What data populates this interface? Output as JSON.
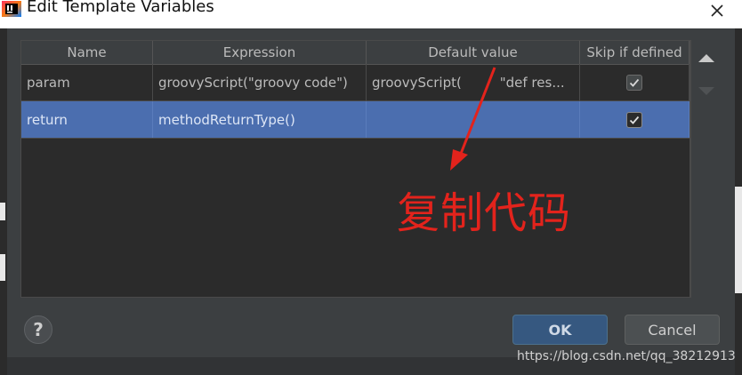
{
  "window": {
    "title": "Edit Template Variables",
    "app_icon": "intellij-icon",
    "close_icon": "close-icon"
  },
  "table": {
    "columns": [
      "Name",
      "Expression",
      "Default value",
      "Skip if defined"
    ],
    "rows": [
      {
        "name": "param",
        "expression": "groovyScript(\"groovy code\")",
        "default_value": "groovyScript(         \"def res...",
        "skip_if_defined": true,
        "selected": false
      },
      {
        "name": "return",
        "expression": "methodReturnType()",
        "default_value": "",
        "skip_if_defined": true,
        "selected": true
      }
    ]
  },
  "side_buttons": {
    "move_up_icon": "triangle-up-icon",
    "move_down_icon": "triangle-down-icon"
  },
  "annotation": {
    "text": "复制代码",
    "color": "#e3231c"
  },
  "footer": {
    "help_label": "?",
    "ok_label": "OK",
    "cancel_label": "Cancel"
  },
  "watermark": "https://blog.csdn.net/qq_38212913",
  "colors": {
    "background": "#3c3f41",
    "selection": "#4b6eaf",
    "ok_button": "#365880"
  }
}
